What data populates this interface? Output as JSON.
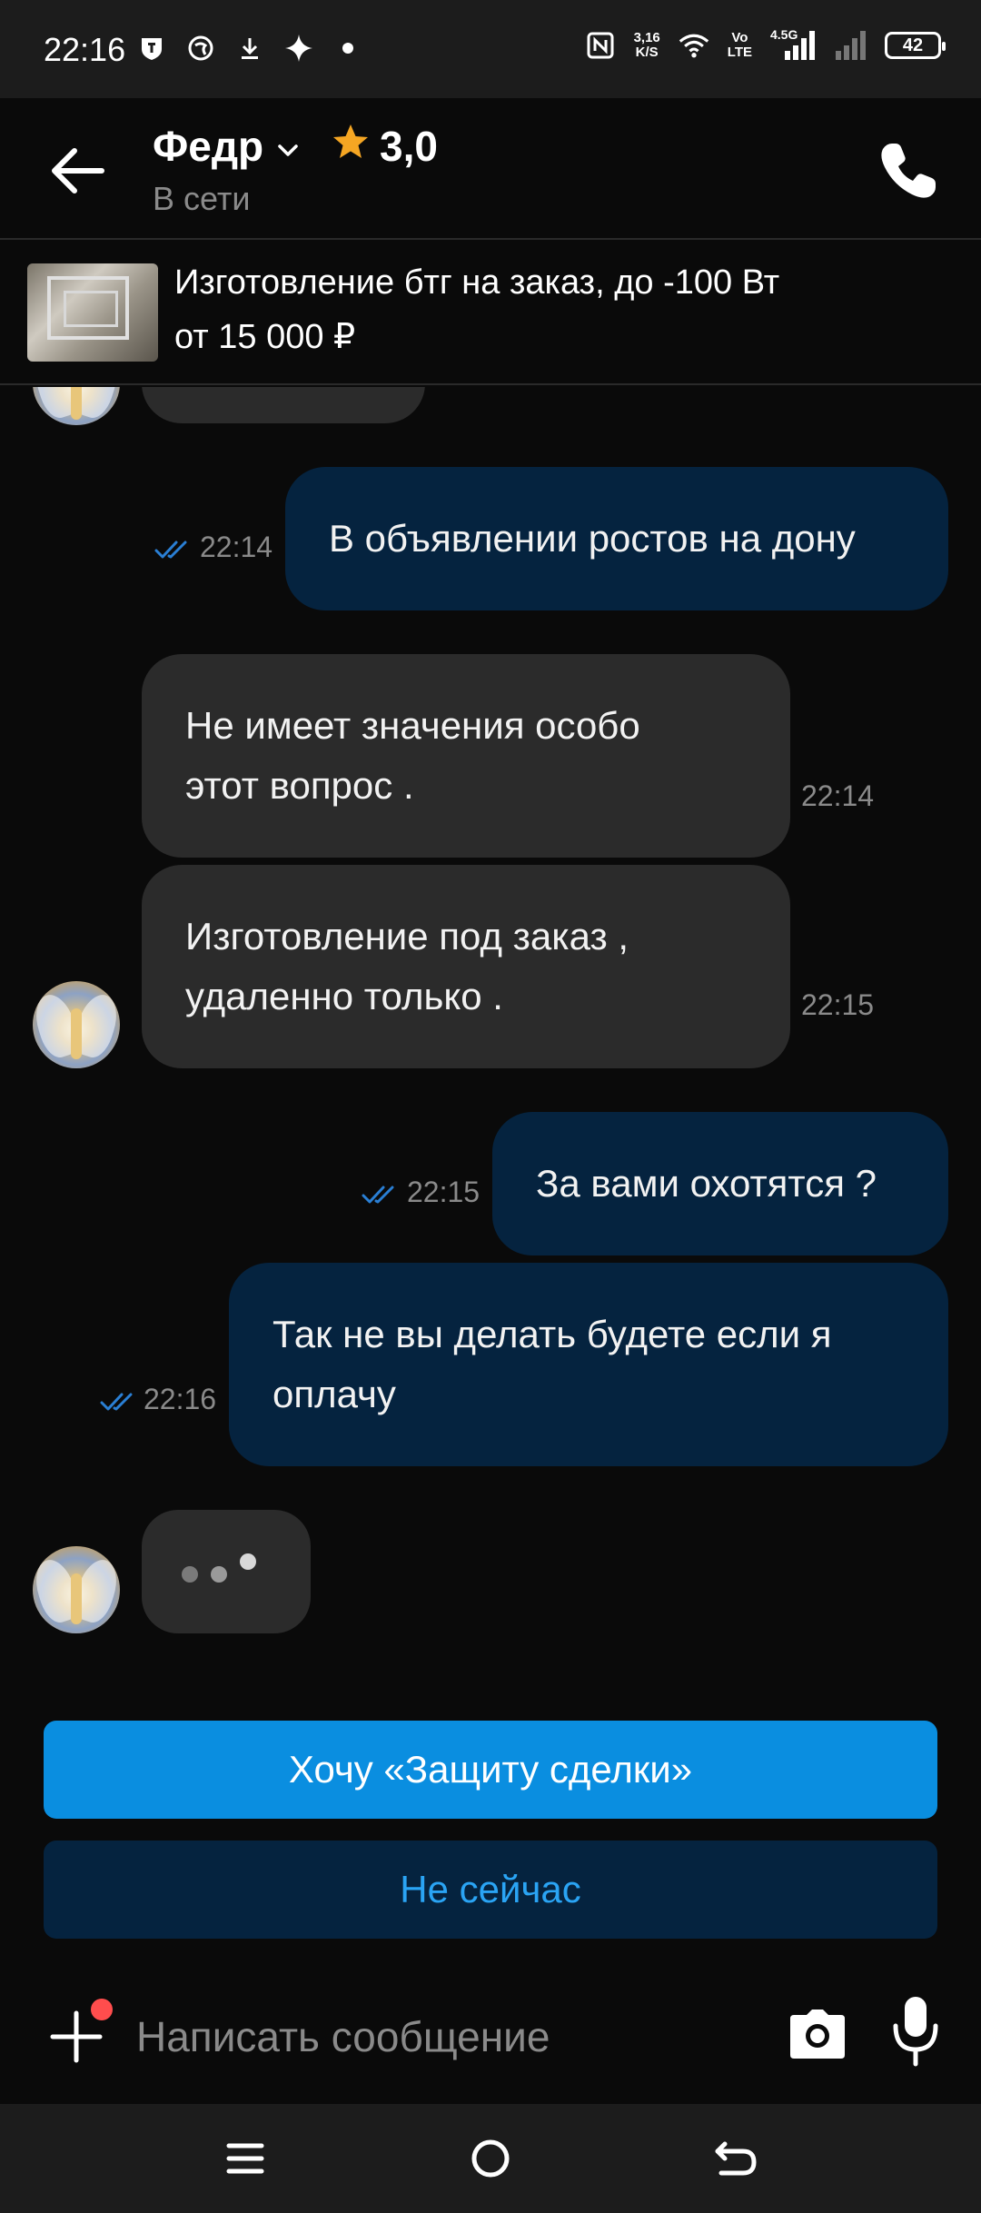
{
  "status_bar": {
    "time": "22:16",
    "net_speed_value": "3,16",
    "net_speed_unit": "K/S",
    "volte_top": "Vo",
    "volte_bottom": "LTE",
    "signal_label": "4.5G",
    "battery": "42"
  },
  "header": {
    "name": "Федр",
    "rating": "3,0",
    "status": "В сети"
  },
  "listing": {
    "title": "Изготовление бтг на заказ, до -100 Вт",
    "price": "от 15 000 ₽"
  },
  "messages": [
    {
      "dir": "out",
      "lines": [
        "В объявлении ростов на дону"
      ],
      "time": "22:14"
    },
    {
      "dir": "in",
      "lines": [
        "Не имеет значения особо",
        "этот вопрос ."
      ],
      "time": "22:14"
    },
    {
      "dir": "in",
      "lines": [
        "Изготовление под заказ ,",
        "удаленно только ."
      ],
      "time": "22:15"
    },
    {
      "dir": "out",
      "lines": [
        "За вами охотятся ?"
      ],
      "time": "22:15"
    },
    {
      "dir": "out",
      "lines": [
        "Так не вы делать будете если я",
        "оплачу"
      ],
      "time": "22:16"
    }
  ],
  "actions": {
    "safe_deal": "Хочу «Защиту сделки»",
    "not_now": "Не сейчас"
  },
  "composer": {
    "placeholder": "Написать сообщение"
  },
  "colors": {
    "background": "#0a0a0a",
    "bubble_in": "#2b2b2b",
    "bubble_out": "#05233f",
    "accent": "#0a8ee0",
    "accent_text": "#2aa4f4",
    "star": "#f5a623",
    "badge": "#ff4d4d"
  },
  "icons": [
    "back-arrow-icon",
    "chevron-down-icon",
    "star-icon",
    "phone-icon",
    "double-check-icon",
    "plus-icon",
    "camera-icon",
    "mic-icon",
    "menu-icon",
    "home-icon",
    "back-icon"
  ]
}
